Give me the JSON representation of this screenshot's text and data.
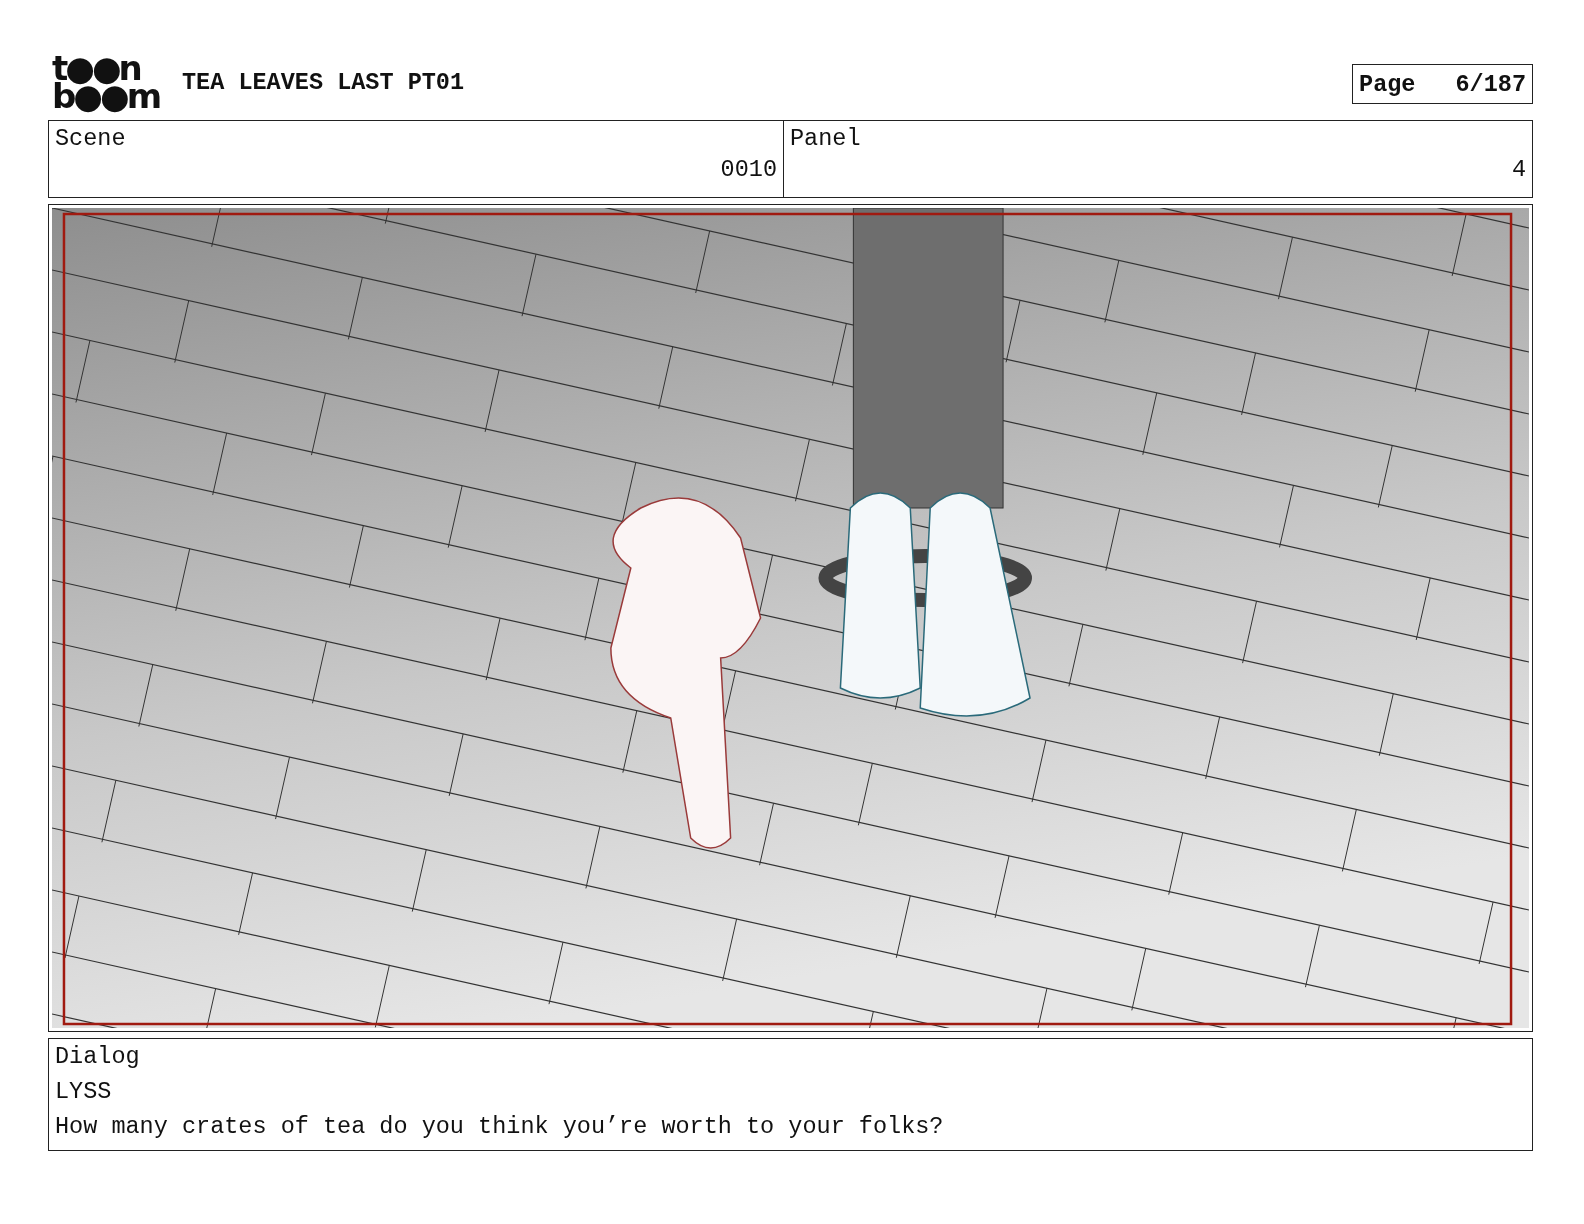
{
  "logo": {
    "lines": [
      "t●●n",
      "b●●m"
    ]
  },
  "title": "TEA LEAVES LAST PT01",
  "page": {
    "label": "Page",
    "value": "6/187"
  },
  "scene": {
    "label": "Scene",
    "value": "0010"
  },
  "panel": {
    "label": "Panel",
    "value": "4"
  },
  "dialog": {
    "label": "Dialog",
    "speaker": "LYSS",
    "line": "How many crates of tea do you think you’re worth to your folks?"
  }
}
